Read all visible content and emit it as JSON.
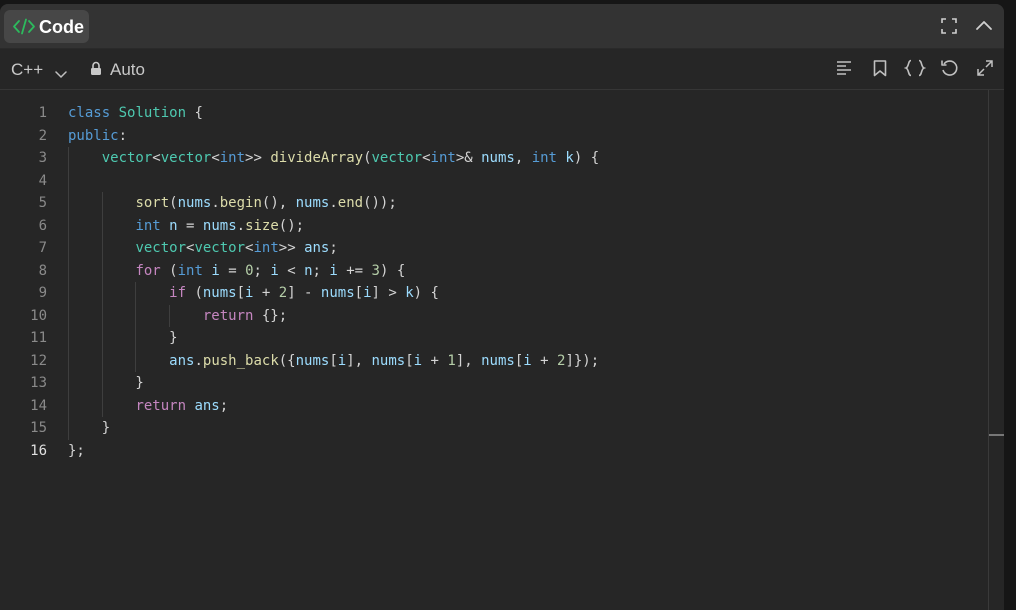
{
  "header": {
    "tab_label": "Code",
    "icons": [
      "code-icon",
      "fullscreen-icon",
      "collapse-icon"
    ]
  },
  "toolbar": {
    "language": "C++",
    "mode": "Auto",
    "icons": [
      "format-icon",
      "bookmark-icon",
      "braces-icon",
      "reset-icon",
      "expand-icon"
    ]
  },
  "editor": {
    "active_line": 16,
    "lines": [
      {
        "no": "1",
        "tokens": [
          [
            "k",
            "class"
          ],
          [
            "p",
            " "
          ],
          [
            "t",
            "Solution"
          ],
          [
            "p",
            " {"
          ]
        ]
      },
      {
        "no": "2",
        "tokens": [
          [
            "k",
            "public"
          ],
          [
            "p",
            ":"
          ]
        ]
      },
      {
        "no": "3",
        "tokens": [
          [
            "p",
            "    "
          ],
          [
            "t",
            "vector"
          ],
          [
            "p",
            "<"
          ],
          [
            "t",
            "vector"
          ],
          [
            "p",
            "<"
          ],
          [
            "k",
            "int"
          ],
          [
            "p",
            ">> "
          ],
          [
            "f",
            "divideArray"
          ],
          [
            "p",
            "("
          ],
          [
            "t",
            "vector"
          ],
          [
            "p",
            "<"
          ],
          [
            "k",
            "int"
          ],
          [
            "p",
            ">& "
          ],
          [
            "v",
            "nums"
          ],
          [
            "p",
            ", "
          ],
          [
            "k",
            "int"
          ],
          [
            "p",
            " "
          ],
          [
            "v",
            "k"
          ],
          [
            "p",
            ") {"
          ]
        ]
      },
      {
        "no": "4",
        "tokens": []
      },
      {
        "no": "5",
        "tokens": [
          [
            "p",
            "        "
          ],
          [
            "f",
            "sort"
          ],
          [
            "p",
            "("
          ],
          [
            "v",
            "nums"
          ],
          [
            "p",
            "."
          ],
          [
            "f",
            "begin"
          ],
          [
            "p",
            "(), "
          ],
          [
            "v",
            "nums"
          ],
          [
            "p",
            "."
          ],
          [
            "f",
            "end"
          ],
          [
            "p",
            "());"
          ]
        ]
      },
      {
        "no": "6",
        "tokens": [
          [
            "p",
            "        "
          ],
          [
            "k",
            "int"
          ],
          [
            "p",
            " "
          ],
          [
            "v",
            "n"
          ],
          [
            "p",
            " = "
          ],
          [
            "v",
            "nums"
          ],
          [
            "p",
            "."
          ],
          [
            "f",
            "size"
          ],
          [
            "p",
            "();"
          ]
        ]
      },
      {
        "no": "7",
        "tokens": [
          [
            "p",
            "        "
          ],
          [
            "t",
            "vector"
          ],
          [
            "p",
            "<"
          ],
          [
            "t",
            "vector"
          ],
          [
            "p",
            "<"
          ],
          [
            "k",
            "int"
          ],
          [
            "p",
            ">> "
          ],
          [
            "v",
            "ans"
          ],
          [
            "p",
            ";"
          ]
        ]
      },
      {
        "no": "8",
        "tokens": [
          [
            "p",
            "        "
          ],
          [
            "kc",
            "for"
          ],
          [
            "p",
            " ("
          ],
          [
            "k",
            "int"
          ],
          [
            "p",
            " "
          ],
          [
            "v",
            "i"
          ],
          [
            "p",
            " = "
          ],
          [
            "n",
            "0"
          ],
          [
            "p",
            "; "
          ],
          [
            "v",
            "i"
          ],
          [
            "p",
            " < "
          ],
          [
            "v",
            "n"
          ],
          [
            "p",
            "; "
          ],
          [
            "v",
            "i"
          ],
          [
            "p",
            " += "
          ],
          [
            "n",
            "3"
          ],
          [
            "p",
            ") {"
          ]
        ]
      },
      {
        "no": "9",
        "tokens": [
          [
            "p",
            "            "
          ],
          [
            "kc",
            "if"
          ],
          [
            "p",
            " ("
          ],
          [
            "v",
            "nums"
          ],
          [
            "p",
            "["
          ],
          [
            "v",
            "i"
          ],
          [
            "p",
            " + "
          ],
          [
            "n",
            "2"
          ],
          [
            "p",
            "] - "
          ],
          [
            "v",
            "nums"
          ],
          [
            "p",
            "["
          ],
          [
            "v",
            "i"
          ],
          [
            "p",
            "] > "
          ],
          [
            "v",
            "k"
          ],
          [
            "p",
            ") {"
          ]
        ]
      },
      {
        "no": "10",
        "tokens": [
          [
            "p",
            "                "
          ],
          [
            "kc",
            "return"
          ],
          [
            "p",
            " {};"
          ]
        ]
      },
      {
        "no": "11",
        "tokens": [
          [
            "p",
            "            }"
          ]
        ]
      },
      {
        "no": "12",
        "tokens": [
          [
            "p",
            "            "
          ],
          [
            "v",
            "ans"
          ],
          [
            "p",
            "."
          ],
          [
            "f",
            "push_back"
          ],
          [
            "p",
            "({"
          ],
          [
            "v",
            "nums"
          ],
          [
            "p",
            "["
          ],
          [
            "v",
            "i"
          ],
          [
            "p",
            "], "
          ],
          [
            "v",
            "nums"
          ],
          [
            "p",
            "["
          ],
          [
            "v",
            "i"
          ],
          [
            "p",
            " + "
          ],
          [
            "n",
            "1"
          ],
          [
            "p",
            "], "
          ],
          [
            "v",
            "nums"
          ],
          [
            "p",
            "["
          ],
          [
            "v",
            "i"
          ],
          [
            "p",
            " + "
          ],
          [
            "n",
            "2"
          ],
          [
            "p",
            "]});"
          ]
        ]
      },
      {
        "no": "13",
        "tokens": [
          [
            "p",
            "        }"
          ]
        ]
      },
      {
        "no": "14",
        "tokens": [
          [
            "p",
            "        "
          ],
          [
            "kc",
            "return"
          ],
          [
            "p",
            " "
          ],
          [
            "v",
            "ans"
          ],
          [
            "p",
            ";"
          ]
        ]
      },
      {
        "no": "15",
        "tokens": [
          [
            "p",
            "    }"
          ]
        ]
      },
      {
        "no": "16",
        "tokens": [
          [
            "p",
            "};"
          ]
        ]
      }
    ]
  }
}
